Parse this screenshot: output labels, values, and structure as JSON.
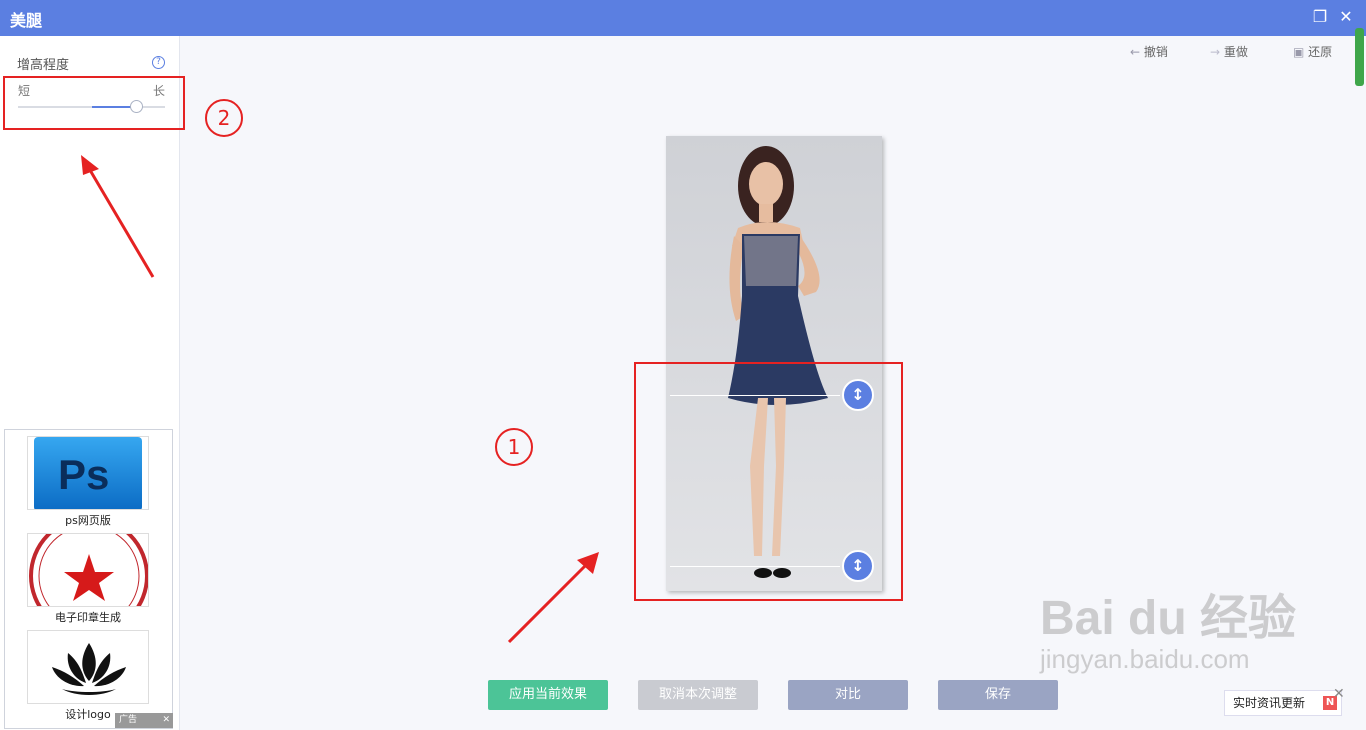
{
  "window": {
    "title": "美腿"
  },
  "sidebar": {
    "param_label": "增高程度",
    "slider": {
      "min_label": "短",
      "max_label": "长",
      "value": 0.8
    }
  },
  "toolbar": {
    "undo": "撤销",
    "redo": "重做",
    "restore": "还原"
  },
  "annotations": {
    "marker1": "1",
    "marker2": "2"
  },
  "ads": [
    {
      "label": "ps网页版",
      "thumb_text": "Ps"
    },
    {
      "label": "电子印章生成"
    },
    {
      "label": "设计logo"
    }
  ],
  "ad_tag": "广告",
  "buttons": {
    "apply": "应用当前效果",
    "cancel": "取消本次调整",
    "compare": "对比",
    "save": "保存"
  },
  "watermark": {
    "main": "Bai du 经验",
    "sub": "jingyan.baidu.com"
  },
  "news": {
    "label": "实时资讯更新",
    "badge": "N"
  }
}
